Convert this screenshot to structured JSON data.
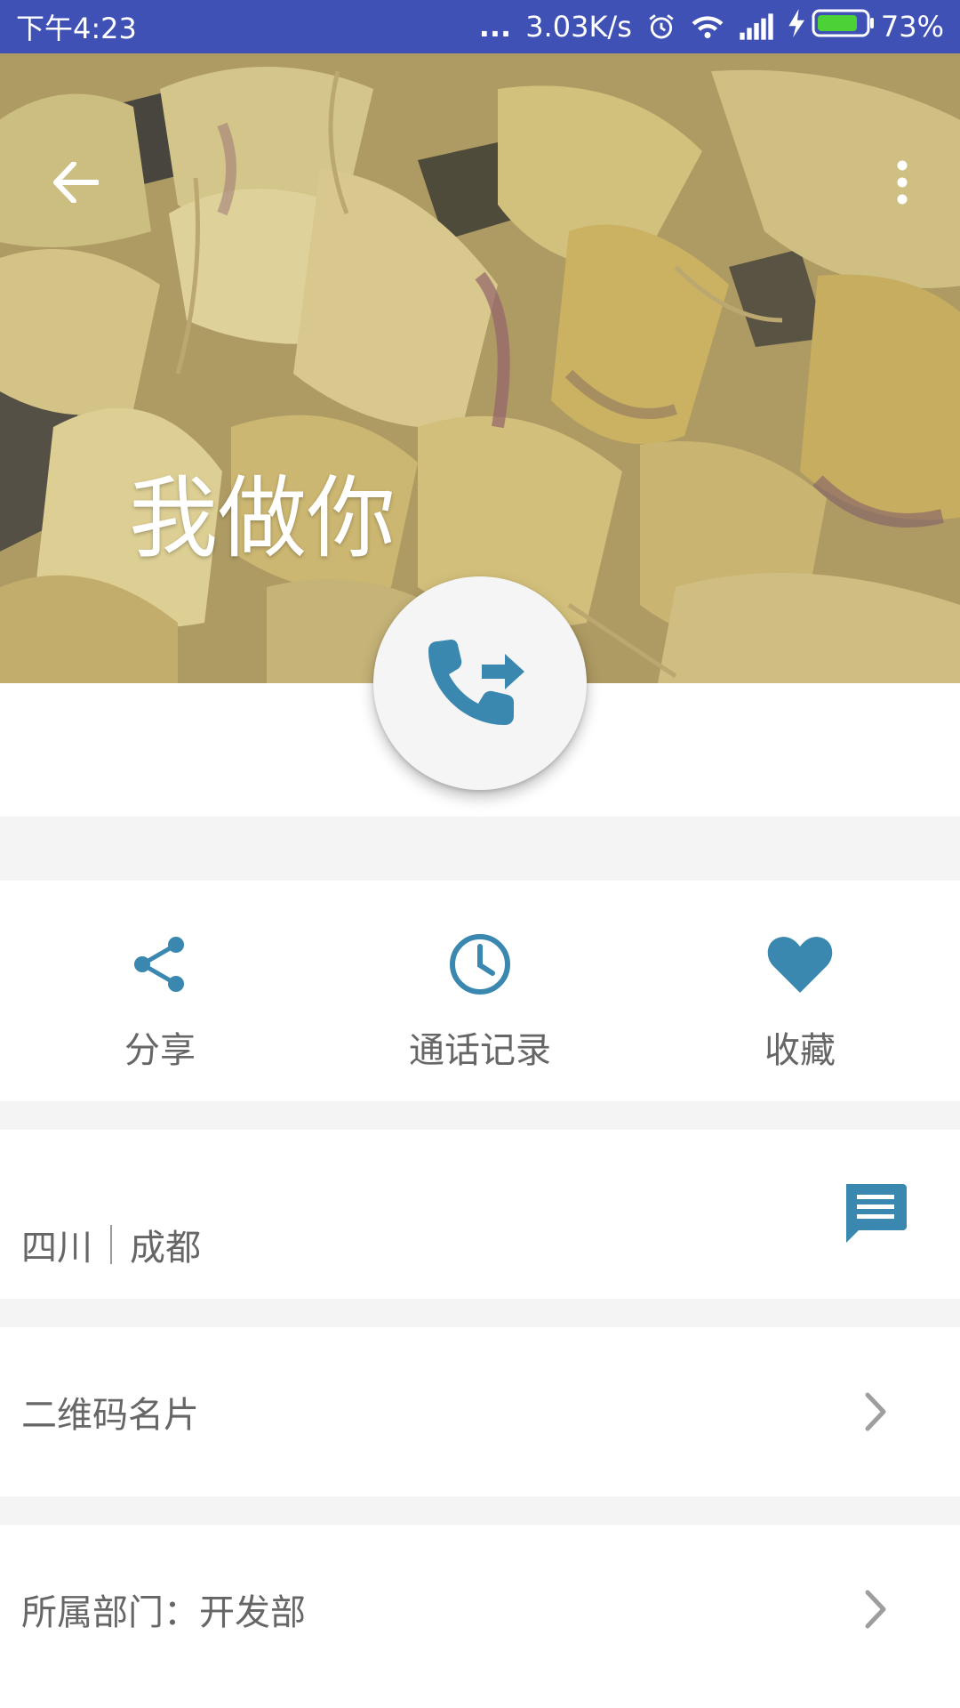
{
  "status_bar": {
    "time": "下午4:23",
    "dots": "...",
    "network_speed": "3.03K/s",
    "battery_percent": "73%",
    "icons": [
      "alarm-icon",
      "wifi-icon",
      "signal-icon",
      "charging-icon",
      "battery-icon"
    ],
    "background": "#3f51b5"
  },
  "header": {
    "contact_name": "我做你",
    "icons": [
      "back-arrow-icon",
      "more-vert-icon"
    ]
  },
  "call_button": {
    "icon": "phone-forward-icon",
    "color": "#3a87b0"
  },
  "actions": [
    {
      "label": "分享",
      "icon": "share-icon"
    },
    {
      "label": "通话记录",
      "icon": "history-clock-icon"
    },
    {
      "label": "收藏",
      "icon": "heart-icon"
    }
  ],
  "location": {
    "province": "四川",
    "city": "成都",
    "icon": "message-icon"
  },
  "list": {
    "qr_card": "二维码名片",
    "department": "所属部门：开发部"
  },
  "colors": {
    "accent": "#3a87b0",
    "text_secondary": "#666666",
    "divider_bg": "#f4f4f4"
  }
}
